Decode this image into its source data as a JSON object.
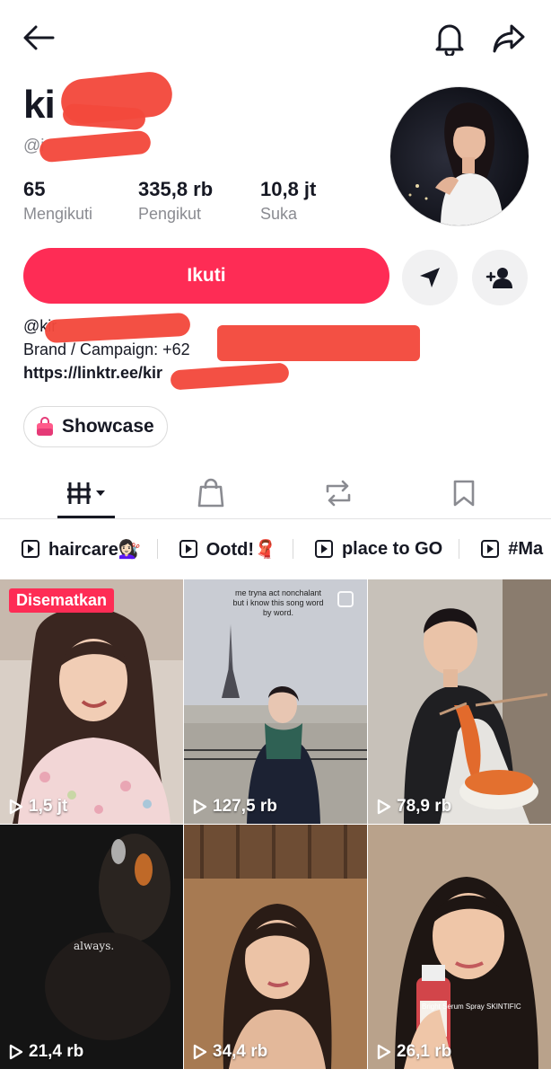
{
  "profile": {
    "name": "ki",
    "handle": "@i",
    "stats": [
      {
        "value": "65",
        "label": "Mengikuti"
      },
      {
        "value": "335,8 rb",
        "label": "Pengikut"
      },
      {
        "value": "10,8 jt",
        "label": "Suka"
      }
    ],
    "follow_label": "Ikuti",
    "bio_lines": [
      "@kir",
      "Brand / Campaign: +62",
      "https://linktr.ee/kir"
    ],
    "showcase_label": "Showcase"
  },
  "tabs": [
    {
      "icon": "videos-grid-icon",
      "active": true
    },
    {
      "icon": "shopping-bag-icon",
      "active": false
    },
    {
      "icon": "repost-icon",
      "active": false
    },
    {
      "icon": "bookmark-icon",
      "active": false
    }
  ],
  "playlists": [
    "haircare💇🏻‍♀️",
    "Ootd!🧣",
    "place to GO",
    "#Ma"
  ],
  "videos": [
    {
      "views": "1,5 jt",
      "pinned_label": "Disematkan"
    },
    {
      "views": "127,5 rb",
      "overlay": "me tryna act nonchalant but i know this song word by word."
    },
    {
      "views": "78,9 rb"
    },
    {
      "views": "21,4 rb",
      "overlay": "always."
    },
    {
      "views": "34,4 rb"
    },
    {
      "views": "26,1 rb",
      "overlay": "Bright Serum Spray SKINTIFIC"
    }
  ],
  "colors": {
    "accent": "#fe2c55",
    "text": "#161823",
    "secondary": "#8a8b91",
    "redaction": "#f2493c"
  }
}
